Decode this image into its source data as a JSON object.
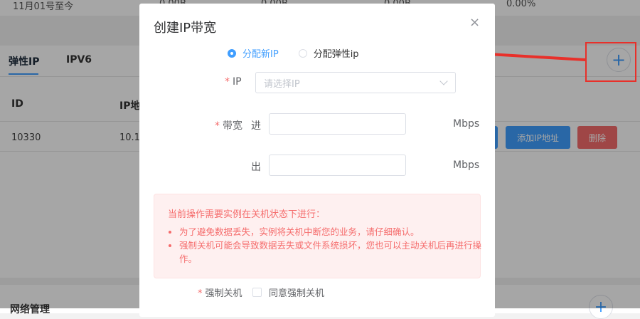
{
  "background": {
    "top_row": {
      "label": "11月01号至今",
      "v1": "0.00B",
      "v2": "0.00B",
      "v3": "0.00B",
      "pct": "0.00%"
    },
    "tabs": [
      "弹性IP",
      "IPV6"
    ],
    "columns": [
      "ID",
      "IP地"
    ],
    "row": {
      "id": "10330",
      "ip": "10.1"
    },
    "buttons": {
      "add_ip": "添加IP地址",
      "delete": "删除"
    },
    "section2_title": "网络管理",
    "add_icon": "plus-icon",
    "colors": {
      "primary": "#409eff",
      "danger": "#f56c6c",
      "annotation": "#e8302a"
    }
  },
  "dialog": {
    "title": "创建IP带宽",
    "close_icon": "×",
    "radio_new": "分配新IP",
    "radio_elastic": "分配弹性ip",
    "ip_label": "IP",
    "ip_placeholder": "请选择IP",
    "bandwidth_label": "带宽",
    "in_label": "进",
    "out_label": "出",
    "unit": "Mbps",
    "alert": {
      "title": "当前操作需要实例在关机状态下进行：",
      "items": [
        "为了避免数据丢失，实例将关机中断您的业务，请仔细确认。",
        "强制关机可能会导致数据丢失或文件系统损坏，您也可以主动关机后再进行操作。"
      ]
    },
    "force_label": "强制关机",
    "force_checkbox": "同意强制关机",
    "required_mark": "*"
  }
}
